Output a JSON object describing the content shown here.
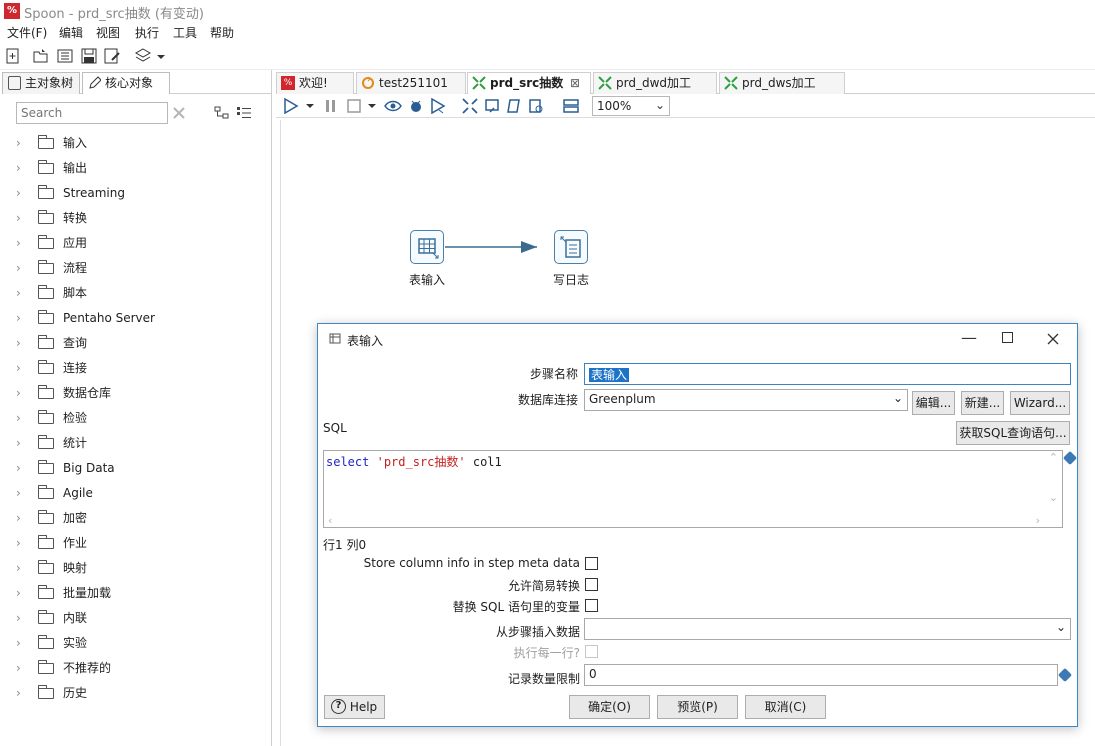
{
  "window": {
    "title": "Spoon - prd_src抽数 (有变动)"
  },
  "menu": [
    "文件(F)",
    "编辑",
    "视图",
    "执行",
    "工具",
    "帮助"
  ],
  "left_panel": {
    "tabs": [
      "主对象树",
      "核心对象"
    ],
    "search_placeholder": "Search",
    "tree": [
      "输入",
      "输出",
      "Streaming",
      "转换",
      "应用",
      "流程",
      "脚本",
      "Pentaho Server",
      "查询",
      "连接",
      "数据仓库",
      "检验",
      "统计",
      "Big Data",
      "Agile",
      "加密",
      "作业",
      "映射",
      "批量加载",
      "内联",
      "实验",
      "不推荐的",
      "历史"
    ]
  },
  "editor_tabs": [
    {
      "label": "欢迎!",
      "icon": "spoon-icon"
    },
    {
      "label": "test251101",
      "icon": "job-icon"
    },
    {
      "label": "prd_src抽数",
      "icon": "transformation-icon",
      "active": true
    },
    {
      "label": "prd_dwd加工",
      "icon": "transformation-icon"
    },
    {
      "label": "prd_dws加工",
      "icon": "transformation-icon"
    }
  ],
  "zoom": "100%",
  "canvas": {
    "steps": [
      {
        "label": "表输入",
        "icon": "table-input-icon"
      },
      {
        "label": "写日志",
        "icon": "write-log-icon"
      }
    ]
  },
  "dialog": {
    "title": "表输入",
    "step_name_label": "步骤名称",
    "step_name_value": "表输入",
    "db_conn_label": "数据库连接",
    "db_conn_value": "Greenplum",
    "btn_edit": "编辑...",
    "btn_new": "新建...",
    "btn_wizard": "Wizard...",
    "sql_label": "SQL",
    "btn_get_sql": "获取SQL查询语句...",
    "sql_keyword": "select",
    "sql_string": "'prd_src抽数'",
    "sql_rest": "col1",
    "cursor_pos": "行1 列0",
    "opt_store_meta": "Store column info in step meta data",
    "opt_lazy_conv": "允许简易转换",
    "opt_replace_vars": "替换 SQL 语句里的变量",
    "insert_from_label": "从步骤插入数据",
    "insert_from_value": "",
    "exec_each_row_label": "执行每一行?",
    "limit_label": "记录数量限制",
    "limit_value": "0",
    "btn_help": "Help",
    "btn_ok": "确定(O)",
    "btn_preview": "预览(P)",
    "btn_cancel": "取消(C)"
  }
}
